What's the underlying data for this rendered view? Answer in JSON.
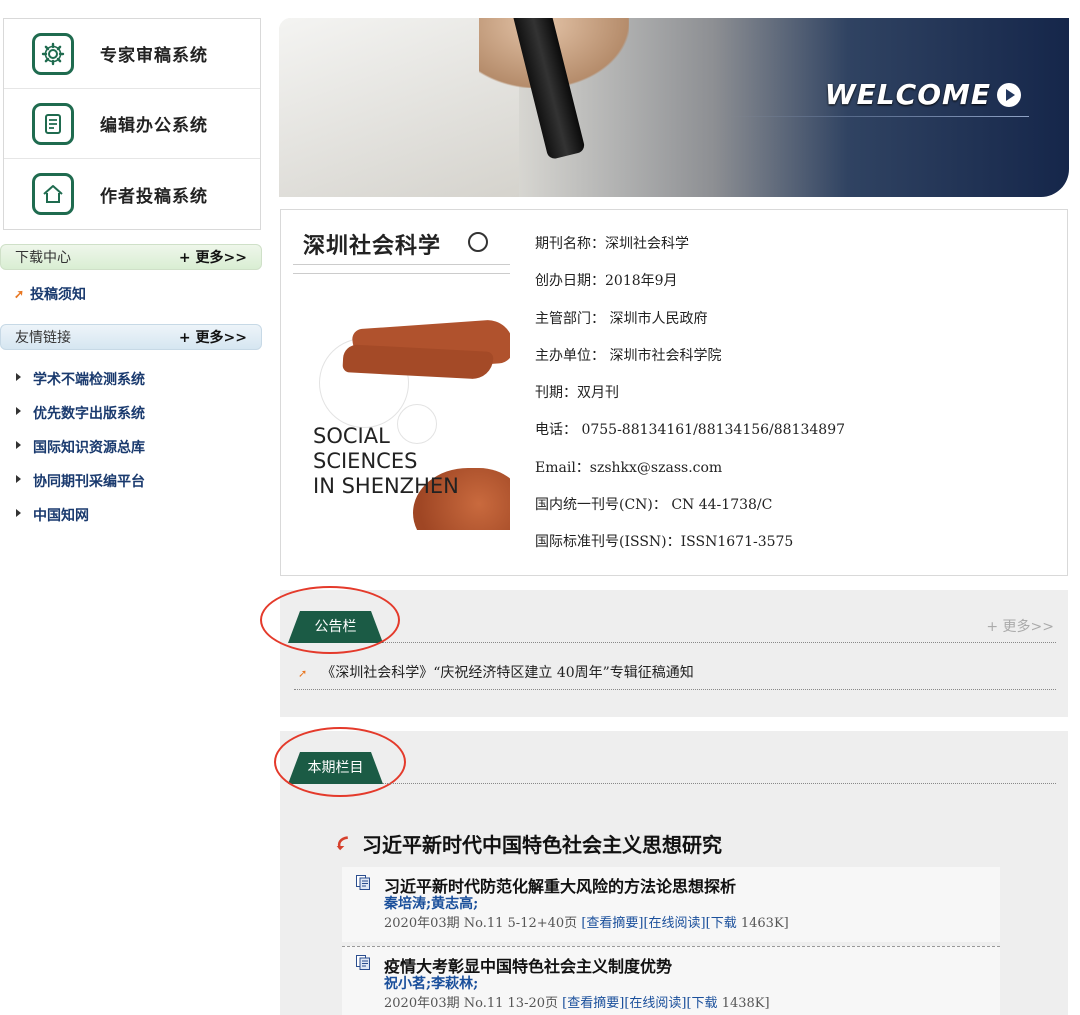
{
  "systems": [
    {
      "label": "专家审稿系统",
      "icon": "gear-icon"
    },
    {
      "label": "编辑办公系统",
      "icon": "document-icon"
    },
    {
      "label": "作者投稿系统",
      "icon": "home-icon"
    }
  ],
  "download": {
    "title": "下载中心",
    "more": "+ 更多>>",
    "items": [
      "投稿须知"
    ]
  },
  "links": {
    "title": "友情链接",
    "more": "+ 更多>>",
    "items": [
      "学术不端检测系统",
      "优先数字出版系统",
      "国际知识资源总库",
      "协同期刊采编平台",
      "中国知网"
    ]
  },
  "banner": {
    "welcome": "WELCOME"
  },
  "cover": {
    "title": "深圳社会科学",
    "english": [
      "SOCIAL",
      "SCIENCES",
      "IN SHENZHEN"
    ]
  },
  "facts": [
    "期刊名称：深圳社会科学",
    "创办日期：2018年9月",
    "主管部门：  深圳市人民政府",
    "主办单位：  深圳市社会科学院",
    "刊期：双月刊",
    "电话：  0755-88134161/88134156/88134897",
    "Email：szshkx@szass.com",
    "国内统一刊号(CN)：  CN 44-1738/C",
    "国际标准刊号(ISSN)：ISSN1671-3575"
  ],
  "notice": {
    "tab": "公告栏",
    "more": "+ 更多>>",
    "item": "《深圳社会科学》“庆祝经济特区建立 40周年”专辑征稿通知"
  },
  "issue": {
    "tab": "本期栏目",
    "column": "习近平新时代中国特色社会主义思想研究",
    "articles": [
      {
        "title": "习近平新时代防范化解重大风险的方法论思想探析",
        "authors": "秦培涛;黄志高;",
        "meta": "2020年03期 No.11 5-12+40页",
        "abstract": "[查看摘要]",
        "read": "[在线阅读]",
        "download": "[下载",
        "size": "1463K]"
      },
      {
        "title": "疫情大考彰显中国特色社会主义制度优势",
        "authors": "祝小茗;李萩林;",
        "meta": "2020年03期 No.11 13-20页",
        "abstract": "[查看摘要]",
        "read": "[在线阅读]",
        "download": "[下载",
        "size": "1438K]"
      }
    ]
  },
  "colors": {
    "green": "#1b5b45",
    "link": "#1a4f9b",
    "orange": "#e87722",
    "annotation": "#e43a2b"
  }
}
